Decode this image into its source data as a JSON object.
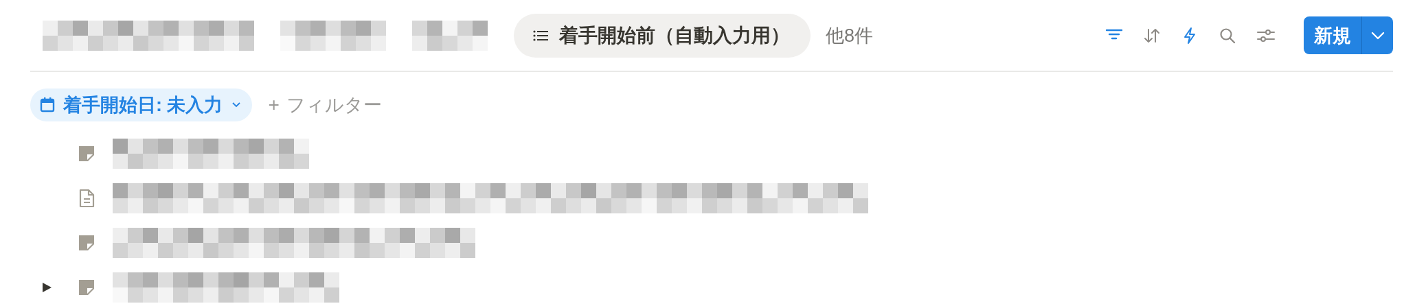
{
  "header": {
    "redacted_titles": [
      {
        "kind": "redacted"
      },
      {
        "kind": "redacted"
      },
      {
        "kind": "redacted"
      }
    ],
    "view_tab": {
      "label": "着手開始前（自動入力用）",
      "selected": true
    },
    "more_views": "他8件",
    "toolbar": [
      {
        "kind": "filter",
        "active": true
      },
      {
        "kind": "sort",
        "active": false
      },
      {
        "kind": "automation",
        "active": true
      },
      {
        "kind": "search",
        "active": false
      },
      {
        "kind": "settings",
        "active": false
      }
    ],
    "new_button": {
      "label": "新規"
    }
  },
  "filters": {
    "chips": [
      {
        "label": "着手開始日: 未入力"
      }
    ],
    "add_filter": {
      "icon": "+",
      "label": "フィルター"
    }
  },
  "rows": [
    {
      "kind": "note",
      "expandable": false,
      "title": {
        "kind": "redacted"
      }
    },
    {
      "kind": "page",
      "expandable": false,
      "title": {
        "kind": "redacted"
      }
    },
    {
      "kind": "note",
      "expandable": false,
      "title": {
        "kind": "redacted"
      }
    },
    {
      "kind": "note",
      "expandable": true,
      "title": {
        "kind": "redacted"
      }
    }
  ]
}
